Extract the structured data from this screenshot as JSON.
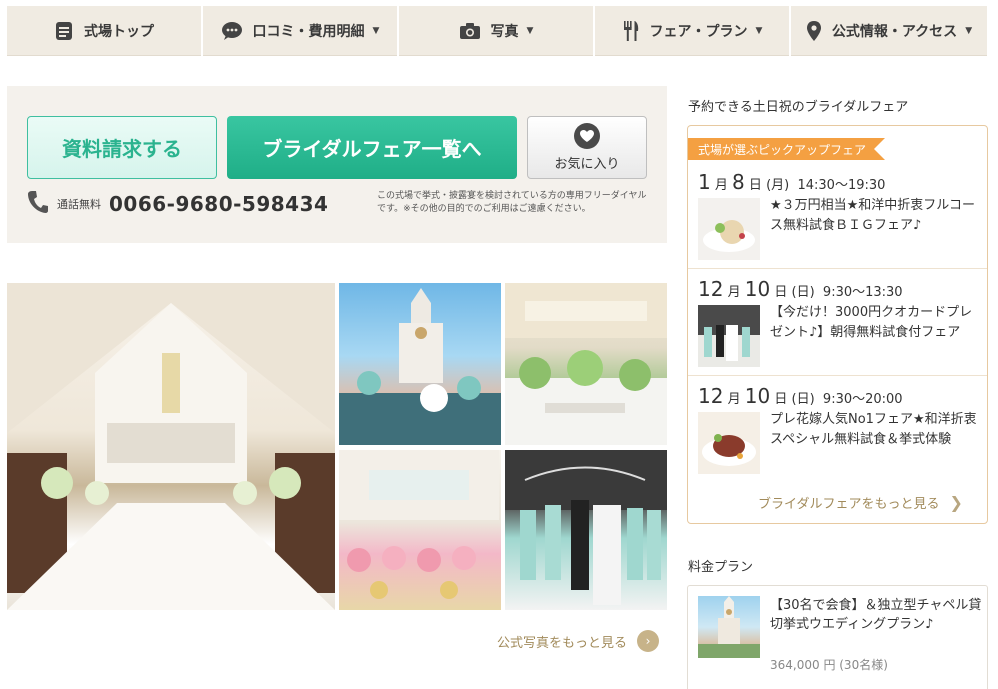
{
  "nav": {
    "items": [
      {
        "label": "式場トップ",
        "icon": "document-icon",
        "has_caret": false
      },
      {
        "label": "口コミ・費用明細",
        "icon": "speech-bubble-icon",
        "has_caret": true
      },
      {
        "label": "写真",
        "icon": "camera-icon",
        "has_caret": true
      },
      {
        "label": "フェア・プラン",
        "icon": "fork-knife-icon",
        "has_caret": true
      },
      {
        "label": "公式情報・アクセス",
        "icon": "map-pin-icon",
        "has_caret": true
      }
    ],
    "caret": "▼"
  },
  "contact": {
    "docs_button": "資料請求する",
    "fair_button": "ブライダルフェア一覧へ",
    "favorite_button": "お気に入り",
    "phone_label": "通話無料",
    "phone_number": "0066-9680-598434",
    "phone_note": "この式場で挙式・披露宴を検討されている方の専用フリーダイヤルです。※その他の目的でのご利用はご遠慮ください。"
  },
  "photos": {
    "more_label": "公式写真をもっと見る"
  },
  "sidebar": {
    "fair_section_title": "予約できる土日祝のブライダルフェア",
    "pickup_label": "式場が選ぶピックアップフェア",
    "fairs": [
      {
        "month": "1",
        "month_unit": "月",
        "day": "8",
        "day_unit": "日",
        "weekday": "(月)",
        "time": "14:30〜19:30",
        "title": "★３万円相当★和洋中折衷フルコース無料試食ＢＩＧフェア♪"
      },
      {
        "month": "12",
        "month_unit": "月",
        "day": "10",
        "day_unit": "日",
        "weekday": "(日)",
        "time": "9:30〜13:30",
        "title": "【今だけ！3000円クオカードプレゼント♪】朝得無料試食付フェア"
      },
      {
        "month": "12",
        "month_unit": "月",
        "day": "10",
        "day_unit": "日",
        "weekday": "(日)",
        "time": "9:30〜20:00",
        "title": "プレ花嫁人気No1フェア★和洋折衷スペシャル無料試食＆挙式体験"
      }
    ],
    "more_fairs_label": "ブライダルフェアをもっと見る",
    "plan_section_title": "料金プラン",
    "plan": {
      "title": "【30名で会食】＆独立型チャペル貸切挙式ウエディングプラン♪",
      "price": "364,000 円 (30名様)"
    }
  },
  "colors": {
    "accent_green": "#1fae87",
    "accent_orange": "#f4a042",
    "link_gold": "#a28b5b"
  }
}
